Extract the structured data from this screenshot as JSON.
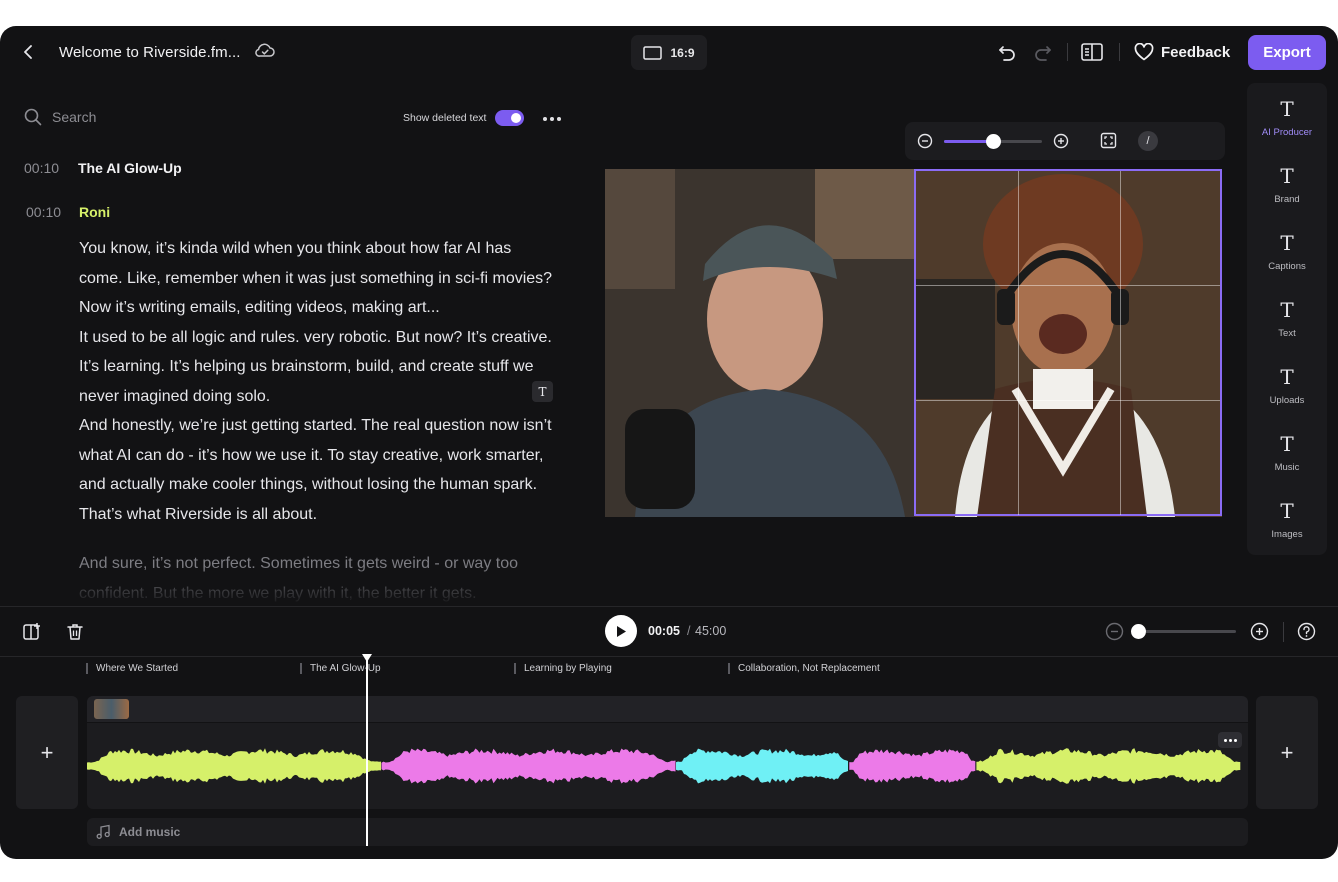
{
  "header": {
    "project_title": "Welcome to Riverside.fm...",
    "aspect_ratio": "16:9",
    "feedback_label": "Feedback",
    "export_label": "Export",
    "accent_color": "#7c5cf0"
  },
  "transcript_panel": {
    "search_placeholder": "Search",
    "show_deleted_label": "Show deleted text",
    "show_deleted_enabled": true,
    "chapter": {
      "timestamp": "00:10",
      "title": "The AI Glow-Up"
    },
    "speaker": {
      "timestamp": "00:10",
      "name": "Roni",
      "color": "#d6f06a"
    },
    "paragraphs": [
      "You know, it’s kinda wild when you think about how far AI has come. Like, remember when it was just something in sci-fi movies? Now it’s writing emails, editing videos, making art...",
      "It used to be all logic and rules. very robotic. But now? It’s creative. It’s learning. It’s helping us brainstorm, build, and create stuff we never imagined doing solo.",
      "And honestly, we’re just getting started. The real question now isn’t what AI can do - it’s how we use it. To stay creative, work smarter, and actually make cooler things, without losing the human spark. That’s what Riverside is all about.",
      "And sure, it’s not perfect. Sometimes it gets weird - or way too confident.  But the more we play with it, the better it gets."
    ],
    "inline_badge": "T"
  },
  "preview": {
    "zoom_level": 0.5,
    "fit_icon": "fullscreen-icon",
    "slash_label": "/"
  },
  "tools": [
    {
      "label": "AI Producer",
      "icon": "text-T-icon",
      "active": true
    },
    {
      "label": "Brand",
      "icon": "text-T-icon",
      "active": false
    },
    {
      "label": "Captions",
      "icon": "text-T-icon",
      "active": false
    },
    {
      "label": "Text",
      "icon": "text-T-icon",
      "active": false
    },
    {
      "label": "Uploads",
      "icon": "text-T-icon",
      "active": false
    },
    {
      "label": "Music",
      "icon": "text-T-icon",
      "active": false
    },
    {
      "label": "Images",
      "icon": "text-T-icon",
      "active": false
    }
  ],
  "timeline": {
    "current_time": "00:05",
    "separator": "/",
    "total_time": "45:00",
    "zoom_level": 0.05,
    "chapters": [
      "Where We Started",
      "The AI Glow-Up",
      "Learning by Playing",
      "Collaboration, Not Replacement"
    ],
    "add_music_label": "Add music",
    "waveform_segments": [
      {
        "speaker_color": "#d6f06a",
        "start": 0.0,
        "end": 0.255
      },
      {
        "speaker_color": "#ec7ae8",
        "start": 0.255,
        "end": 0.51
      },
      {
        "speaker_color": "#6ff0f5",
        "start": 0.51,
        "end": 0.66
      },
      {
        "speaker_color": "#ec7ae8",
        "start": 0.66,
        "end": 0.77
      },
      {
        "speaker_color": "#d6f06a",
        "start": 0.77,
        "end": 1.0
      }
    ]
  }
}
